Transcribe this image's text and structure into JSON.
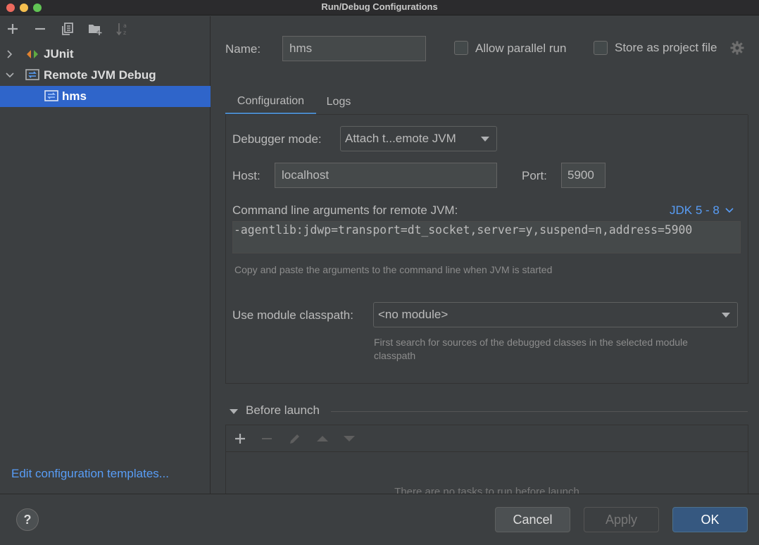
{
  "window": {
    "title": "Run/Debug Configurations"
  },
  "tree": {
    "items": [
      {
        "label": "JUnit"
      },
      {
        "label": "Remote JVM Debug"
      },
      {
        "label": "hms"
      }
    ],
    "edit_templates_link": "Edit configuration templates..."
  },
  "form": {
    "name_label": "Name:",
    "name_value": "hms",
    "allow_parallel_label": "Allow parallel run",
    "store_project_label": "Store as project file"
  },
  "tabs": [
    {
      "label": "Configuration",
      "active": true
    },
    {
      "label": "Logs",
      "active": false
    }
  ],
  "config": {
    "debugger_mode_label": "Debugger mode:",
    "debugger_mode_value": "Attach t...emote JVM",
    "host_label": "Host:",
    "host_value": "localhost",
    "port_label": "Port:",
    "port_value": "5900",
    "cmd_label": "Command line arguments for remote JVM:",
    "jdk_label": "JDK 5 - 8",
    "cmd_value": "-agentlib:jdwp=transport=dt_socket,server=y,suspend=n,address=5900",
    "cmd_hint": "Copy and paste the arguments to the command line when JVM is started",
    "module_label": "Use module classpath:",
    "module_value": "<no module>",
    "module_hint": "First search for sources of the debugged classes in the selected module classpath"
  },
  "before_launch": {
    "title": "Before launch",
    "empty_text": "There are no tasks to run before launch"
  },
  "footer": {
    "help_label": "?",
    "cancel_label": "Cancel",
    "apply_label": "Apply",
    "ok_label": "OK"
  },
  "colors": {
    "selection": "#2f65ca",
    "link": "#589df6",
    "primary_button": "#365880",
    "active_tab": "#4a88c7"
  }
}
